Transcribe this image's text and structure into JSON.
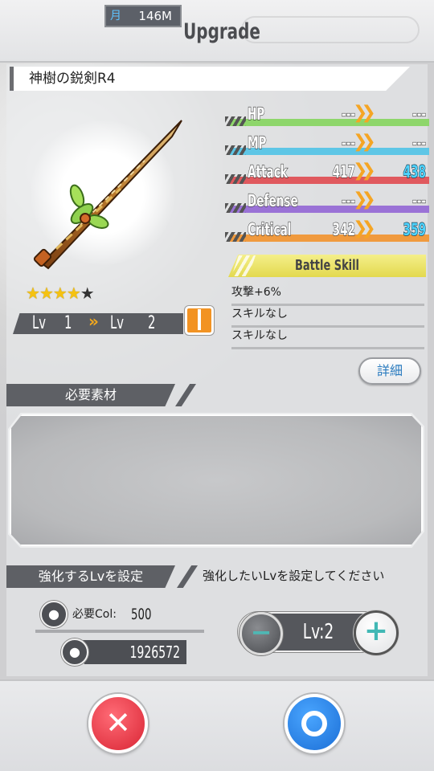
{
  "header": {
    "currency_value": "146M",
    "title": "Upgrade"
  },
  "item": {
    "name": "神樹の鋭剣R4",
    "stars_filled": 4,
    "stars_total": 5,
    "lv_label": "Lv",
    "lv_current": "1",
    "lv_next": "2",
    "lv_arrow": "»"
  },
  "stats": [
    {
      "label": "HP",
      "current": "---",
      "next": "---",
      "color": "#8ed66b",
      "improved": false
    },
    {
      "label": "MP",
      "current": "---",
      "next": "---",
      "color": "#5ec6e6",
      "improved": false
    },
    {
      "label": "Attack",
      "current": "417",
      "next": "438",
      "color": "#e0595e",
      "improved": true
    },
    {
      "label": "Defense",
      "current": "---",
      "next": "---",
      "color": "#9a72d6",
      "improved": false
    },
    {
      "label": "Critical",
      "current": "342",
      "next": "359",
      "color": "#f09a3e",
      "improved": true
    }
  ],
  "battle_skill": {
    "title": "Battle Skill",
    "lines": [
      "攻撃+6%",
      "スキルなし",
      "スキルなし"
    ],
    "detail_button": "詳細"
  },
  "materials": {
    "header": "必要素材"
  },
  "level_set": {
    "header": "強化するLvを設定",
    "hint": "強化したいLvを設定してください",
    "required_col_label": "必要Col:",
    "required_col_value": "500",
    "owned_col": "1926572",
    "level_display": "Lv:2",
    "minus_symbol": "−",
    "plus_symbol": "+"
  },
  "footer": {
    "cancel_symbol": "✕"
  },
  "colors": {
    "accent_orange": "#f3a81c",
    "cancel_red": "#e03340",
    "ok_blue": "#2a85e8",
    "panel_dark": "#5e6065"
  }
}
